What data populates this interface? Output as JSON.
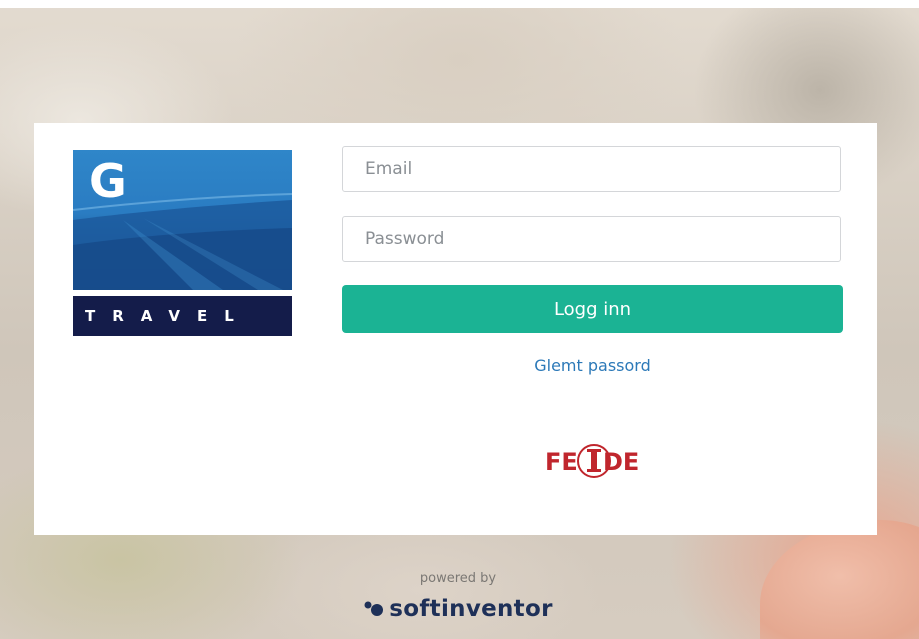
{
  "app": {
    "brand": {
      "logo_letter": "G",
      "logo_word": "TRAVEL",
      "colors": {
        "logo_blue": "#2f86c9",
        "logo_navy": "#141c4a"
      }
    }
  },
  "login_form": {
    "email_placeholder": "Email",
    "email_value": "",
    "password_placeholder": "Password",
    "password_value": "",
    "submit_label": "Logg inn",
    "forgot_label": "Glemt passord",
    "accent_color": "#1bb394",
    "link_color": "#2c79b8"
  },
  "sso": {
    "provider_label": "FEIDE",
    "icon": "feide-logo",
    "color": "#c0262d"
  },
  "footer": {
    "powered_by": "powered by",
    "vendor": "softinventor",
    "vendor_icon": "softinventor-dots"
  }
}
